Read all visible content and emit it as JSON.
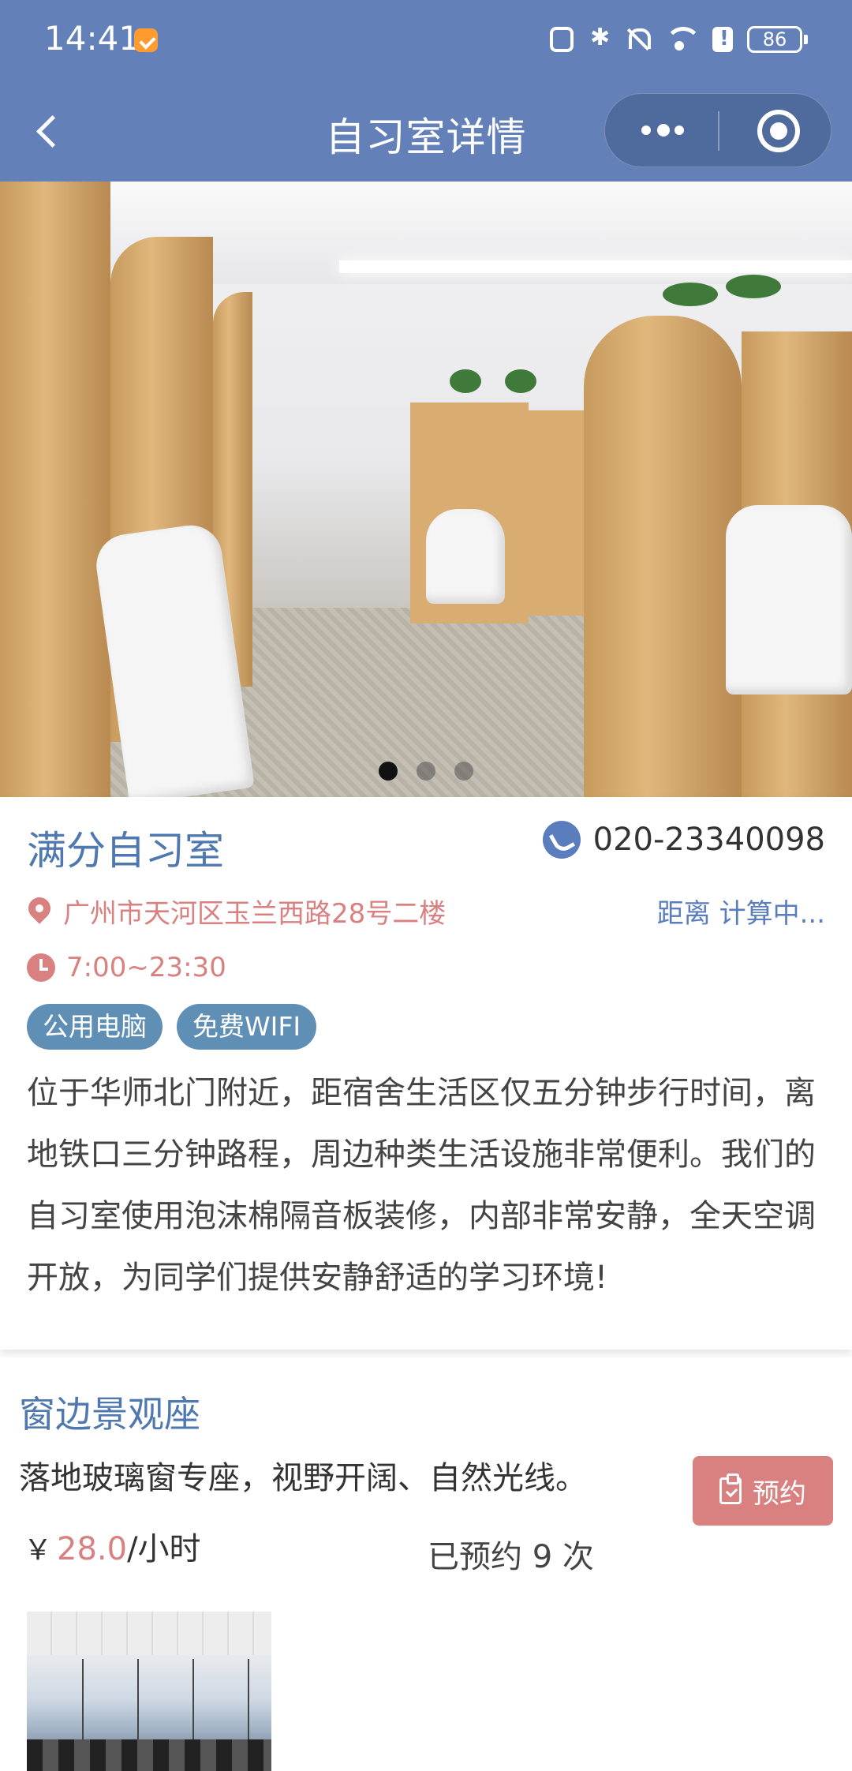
{
  "status_bar": {
    "time": "14:41",
    "battery": "86",
    "icons": [
      "nfc-icon",
      "bluetooth-icon",
      "mute-icon",
      "wifi-icon",
      "alert-icon",
      "battery-icon"
    ]
  },
  "nav": {
    "title": "自习室详情",
    "back_icon": "chevron-left-icon",
    "more_icon": "more-dots-icon",
    "close_icon": "target-circle-icon"
  },
  "banner": {
    "slide_count": 3,
    "active_index": 0
  },
  "room": {
    "name": "满分自习室",
    "phone": "020-23340098",
    "address": "广州市天河区玉兰西路28号二楼",
    "distance": "距离 计算中...",
    "hours": "7:00~23:30",
    "tags": [
      "公用电脑",
      "免费WIFI"
    ],
    "description": "位于华师北门附近，距宿舍生活区仅五分钟步行时间，离地铁口三分钟路程，周边种类生活设施非常便利。我们的自习室使用泡沫棉隔音板装修，内部非常安静，全天空调开放，为同学们提供安静舒适的学习环境!"
  },
  "seat": {
    "name": "窗边景观座",
    "description": "落地玻璃窗专座，视野开阔、自然光线。",
    "book_label": "预约",
    "currency": "￥",
    "price": "28.0",
    "unit": "/小时",
    "booked": "已预约 9 次"
  },
  "colors": {
    "header": "#6381b8",
    "accent_blue": "#4f78b0",
    "accent_red": "#d98180",
    "tag_bg": "#5f8fb4"
  }
}
